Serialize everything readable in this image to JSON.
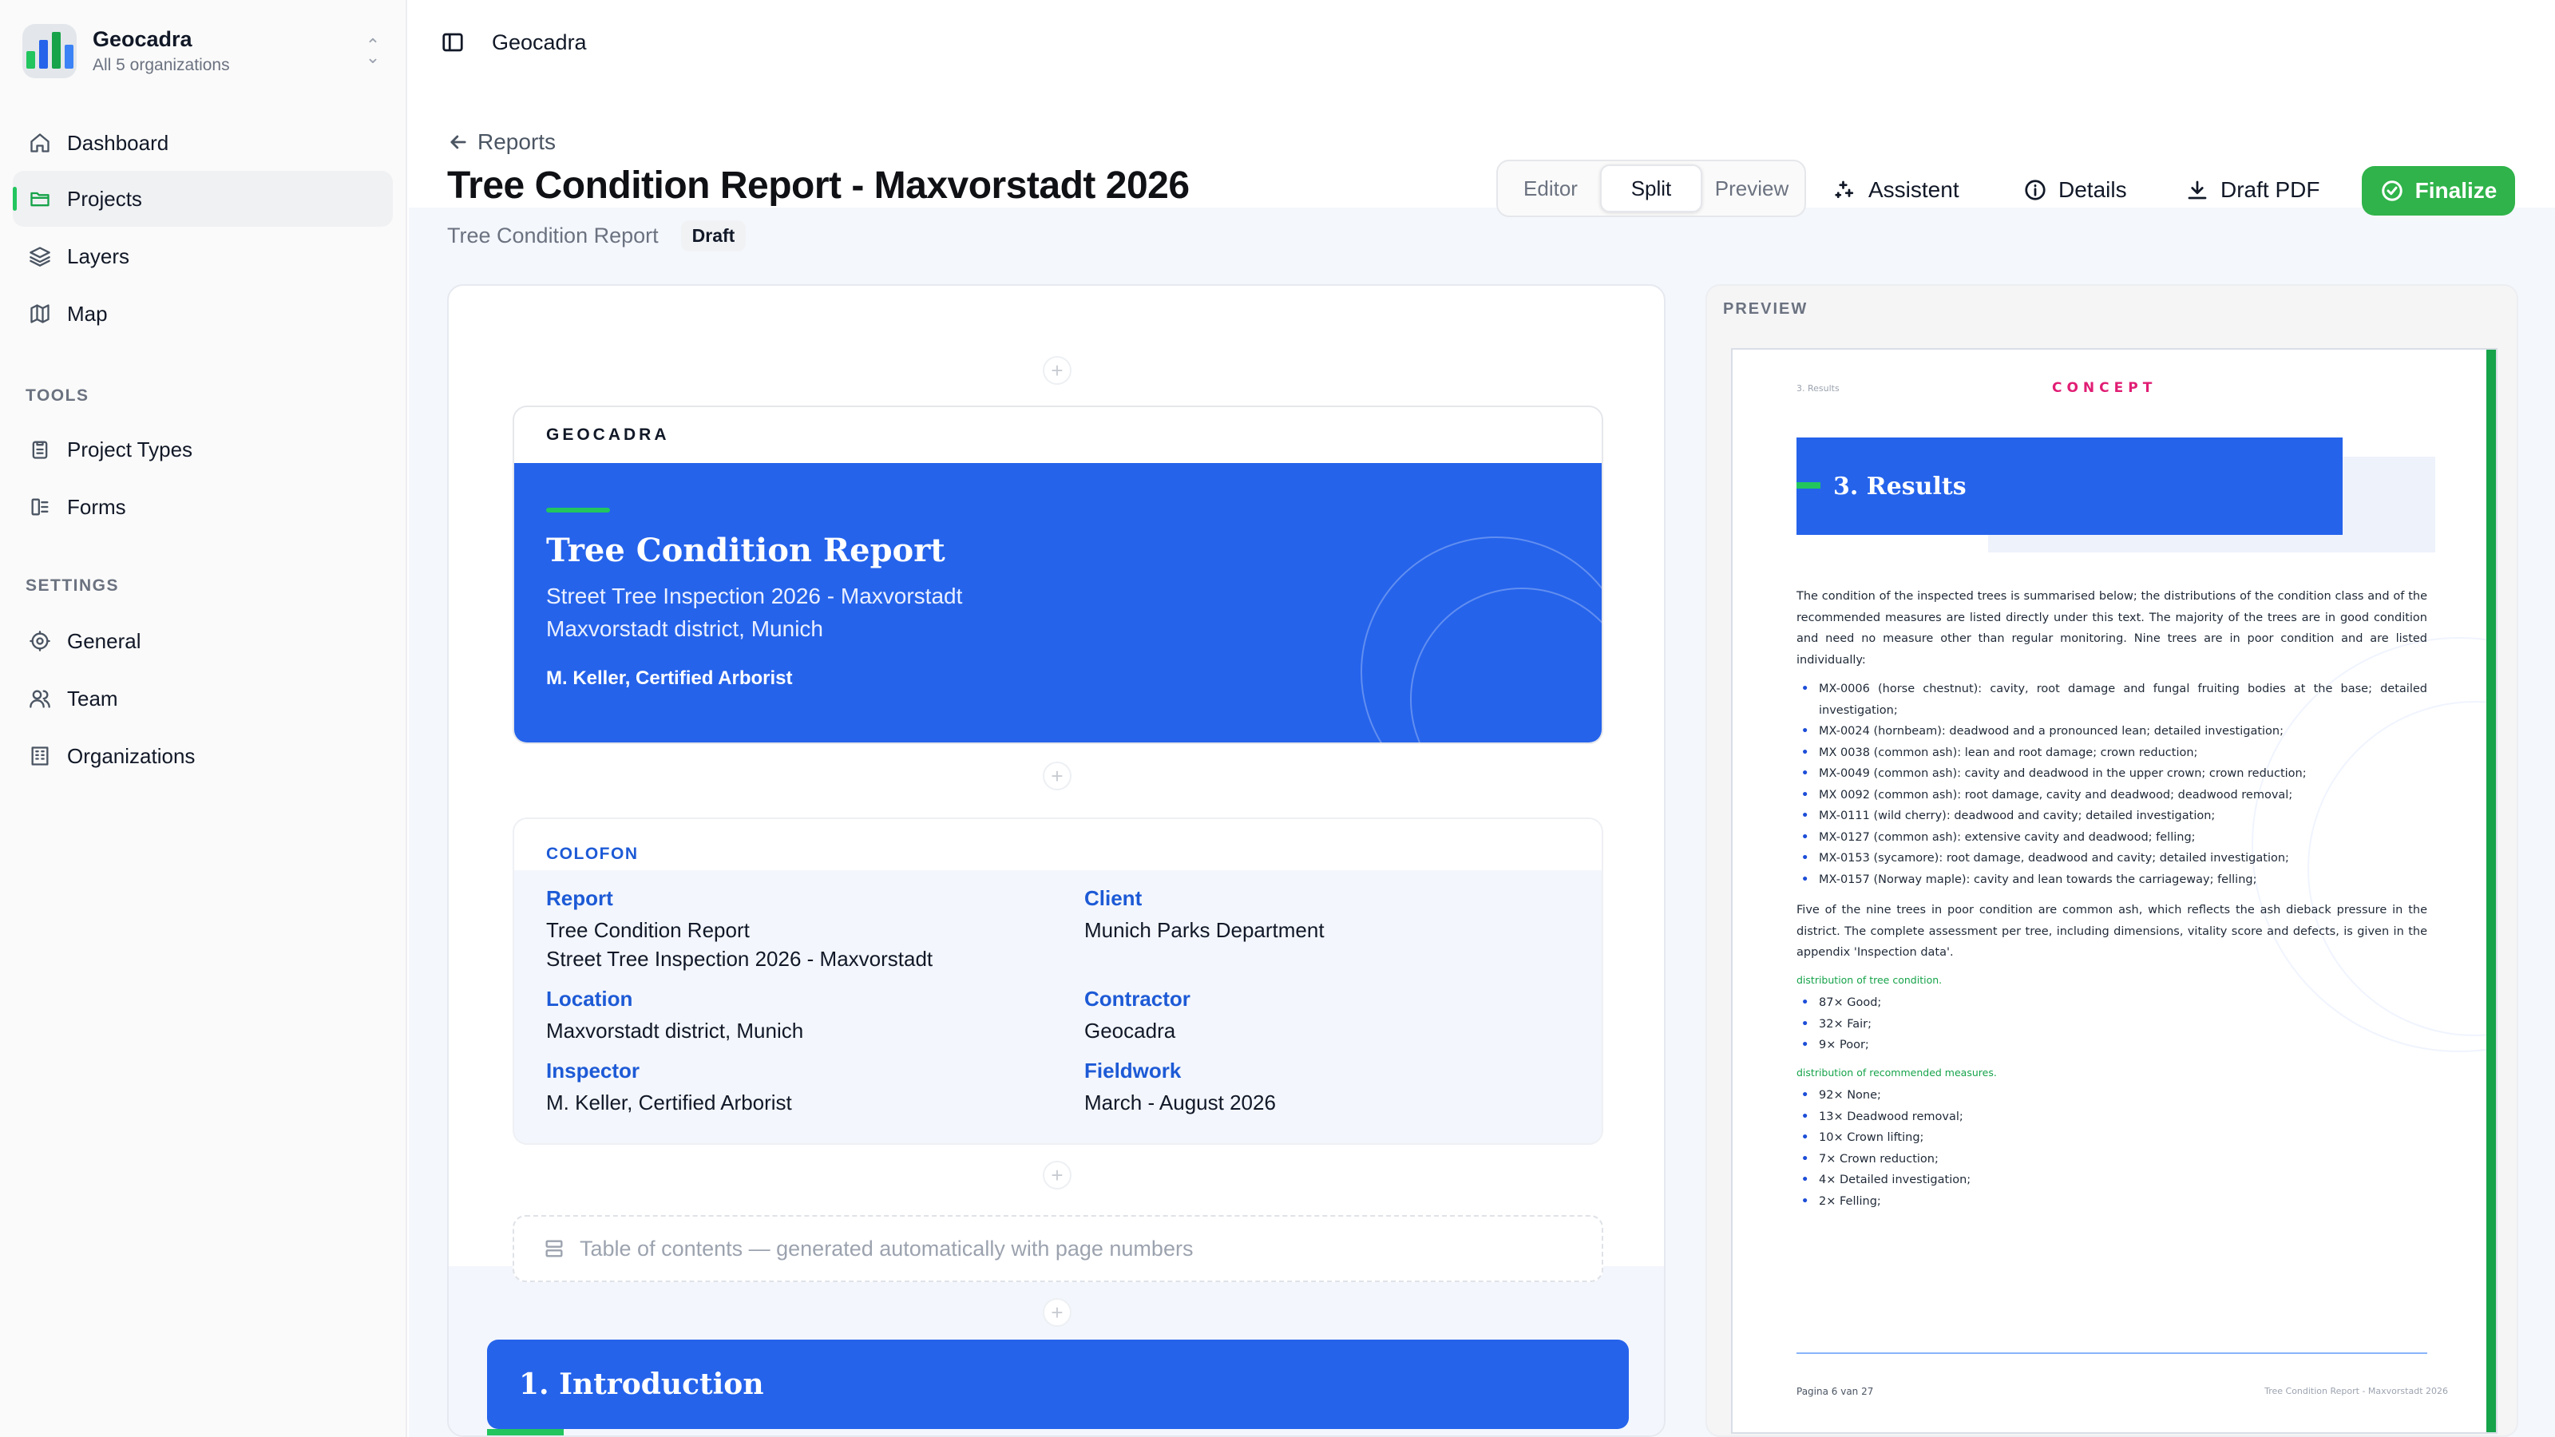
{
  "org": {
    "name": "Geocadra",
    "subtitle": "All 5 organizations"
  },
  "nav": {
    "main": [
      {
        "label": "Dashboard",
        "icon": "home-icon"
      },
      {
        "label": "Projects",
        "icon": "folder-icon",
        "active": true
      },
      {
        "label": "Layers",
        "icon": "layers-icon"
      },
      {
        "label": "Map",
        "icon": "map-icon"
      }
    ],
    "tools_label": "TOOLS",
    "tools": [
      {
        "label": "Project Types",
        "icon": "clipboard-icon"
      },
      {
        "label": "Forms",
        "icon": "form-icon"
      }
    ],
    "settings_label": "SETTINGS",
    "settings": [
      {
        "label": "General",
        "icon": "gear-icon"
      },
      {
        "label": "Team",
        "icon": "users-icon"
      },
      {
        "label": "Organizations",
        "icon": "building-icon"
      }
    ]
  },
  "topbar": {
    "breadcrumb": "Geocadra"
  },
  "header": {
    "back_label": "Reports",
    "title": "Tree Condition Report - Maxvorstadt 2026",
    "report_type": "Tree Condition Report",
    "status": "Draft",
    "view_modes": [
      "Editor",
      "Split",
      "Preview"
    ],
    "active_view": "Split",
    "actions": {
      "assistant": "Assistent",
      "details": "Details",
      "draft_pdf": "Draft PDF",
      "finalize": "Finalize"
    }
  },
  "editor": {
    "cover": {
      "brand": "GEOCADRA",
      "title": "Tree Condition Report",
      "subtitle_1": "Street Tree Inspection 2026 - Maxvorstadt",
      "subtitle_2": "Maxvorstadt district, Munich",
      "author": "M. Keller, Certified Arborist"
    },
    "colofon": {
      "heading": "COLOFON",
      "report_label": "Report",
      "report_1": "Tree Condition Report",
      "report_2": "Street Tree Inspection 2026 - Maxvorstadt",
      "client_label": "Client",
      "client": "Munich Parks Department",
      "location_label": "Location",
      "location": "Maxvorstadt district, Munich",
      "contractor_label": "Contractor",
      "contractor": "Geocadra",
      "inspector_label": "Inspector",
      "inspector": "M. Keller, Certified Arborist",
      "fieldwork_label": "Fieldwork",
      "fieldwork": "March - August 2026"
    },
    "toc_placeholder": "Table of contents — generated automatically with page numbers",
    "intro_heading": "1.  Introduction",
    "add_block_symbol": "+"
  },
  "preview": {
    "label": "PREVIEW",
    "page": {
      "crumb": "3. Results",
      "watermark": "CONCEPT",
      "heading": "3.  Results",
      "intro": "The condition of the inspected trees is summarised below; the distributions of the condition class and of the recommended measures are listed directly under this text. The majority of the trees are in good condition and need no measure other than regular monitoring. Nine trees are in poor condition and are listed individually:",
      "poor_trees": [
        "MX-0006 (horse chestnut): cavity, root damage and fungal fruiting bodies at the base; detailed investigation;",
        "MX-0024 (hornbeam): deadwood and a pronounced lean; detailed investigation;",
        "MX 0038 (common ash): lean and root damage; crown reduction;",
        "MX-0049 (common ash): cavity and deadwood in the upper crown; crown reduction;",
        "MX 0092 (common ash): root damage, cavity and deadwood; deadwood removal;",
        "MX-0111 (wild cherry): deadwood and cavity; detailed investigation;",
        "MX-0127 (common ash): extensive cavity and deadwood; felling;",
        "MX-0153 (sycamore): root damage, deadwood and cavity; detailed investigation;",
        "MX-0157 (Norway maple): cavity and lean towards the carriageway; felling;"
      ],
      "ash_note": "Five of the nine trees in poor condition are common ash, which reflects the ash dieback pressure in the district. The complete assessment per tree, including dimensions, vitality score and defects, is given in the appendix 'Inspection data'.",
      "condition_heading": "distribution of tree condition.",
      "condition": [
        "87× Good;",
        "32× Fair;",
        "9× Poor;"
      ],
      "measures_heading": "distribution of recommended measures.",
      "measures": [
        "92× None;",
        "13× Deadwood removal;",
        "10× Crown lifting;",
        "7× Crown reduction;",
        "4× Detailed investigation;",
        "2× Felling;"
      ],
      "footer_left": "Pagina 6 van 27",
      "footer_right": "Tree Condition Report - Maxvorstadt 2026"
    }
  },
  "colors": {
    "accent_blue": "#2563eb",
    "accent_green": "#22c55e",
    "finalize_green": "#2fb34a",
    "watermark_pink": "#e11d74"
  }
}
